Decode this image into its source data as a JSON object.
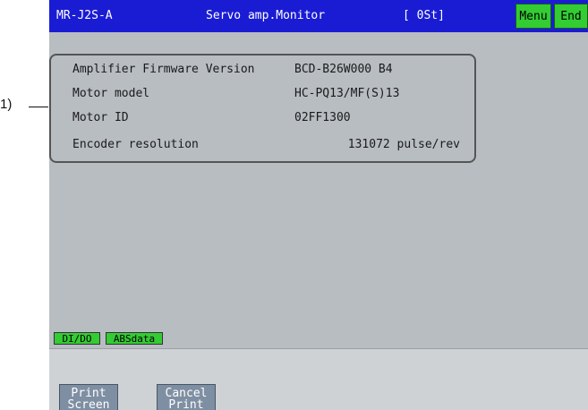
{
  "callout": {
    "label": "1)"
  },
  "header": {
    "model": "MR-J2S-A",
    "title": "Servo amp.Monitor",
    "status": "[ 0St]",
    "menu_label": "Menu",
    "end_label": "End"
  },
  "info": {
    "rows": [
      {
        "label": "Amplifier Firmware Version",
        "value": "BCD-B26W000 B4"
      },
      {
        "label": "Motor model",
        "value": "HC-PQ13/MF(S)13"
      },
      {
        "label": "Motor ID",
        "value": "02FF1300"
      },
      {
        "label": "Encoder resolution",
        "value": "131072 pulse/rev"
      }
    ]
  },
  "tags": {
    "dido": "DI/DO",
    "absdata": "ABSdata"
  },
  "footer": {
    "print_screen_line1": "Print",
    "print_screen_line2": "Screen",
    "cancel_print_line1": "Cancel",
    "cancel_print_line2": "Print"
  },
  "colors": {
    "titlebar": "#1a1cd4",
    "screen_bg": "#b8bdc2",
    "button_green": "#33cc33",
    "print_button": "#7f8fa3"
  }
}
